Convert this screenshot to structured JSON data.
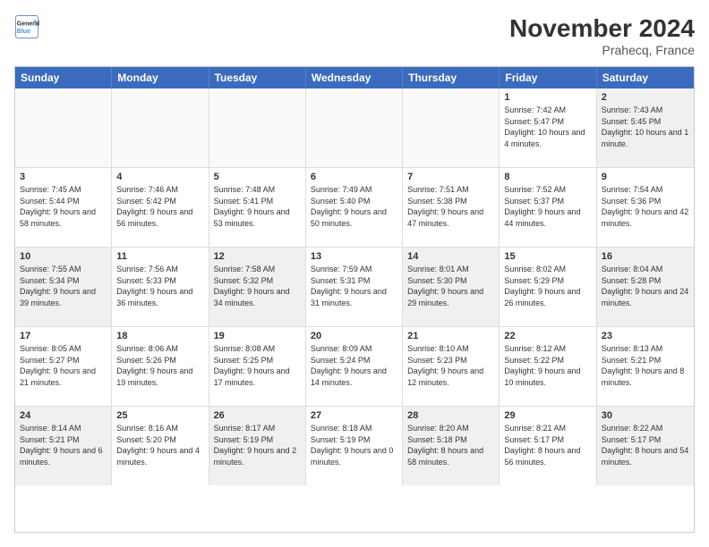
{
  "logo": {
    "line1": "General",
    "line2": "Blue"
  },
  "header": {
    "month_year": "November 2024",
    "location": "Prahecq, France"
  },
  "weekdays": [
    "Sunday",
    "Monday",
    "Tuesday",
    "Wednesday",
    "Thursday",
    "Friday",
    "Saturday"
  ],
  "rows": [
    [
      {
        "day": "",
        "empty": true
      },
      {
        "day": "",
        "empty": true
      },
      {
        "day": "",
        "empty": true
      },
      {
        "day": "",
        "empty": true
      },
      {
        "day": "",
        "empty": true
      },
      {
        "day": "1",
        "sunrise": "7:42 AM",
        "sunset": "5:47 PM",
        "daylight": "10 hours and 4 minutes."
      },
      {
        "day": "2",
        "sunrise": "7:43 AM",
        "sunset": "5:45 PM",
        "daylight": "10 hours and 1 minute."
      }
    ],
    [
      {
        "day": "3",
        "sunrise": "7:45 AM",
        "sunset": "5:44 PM",
        "daylight": "9 hours and 58 minutes."
      },
      {
        "day": "4",
        "sunrise": "7:46 AM",
        "sunset": "5:42 PM",
        "daylight": "9 hours and 56 minutes."
      },
      {
        "day": "5",
        "sunrise": "7:48 AM",
        "sunset": "5:41 PM",
        "daylight": "9 hours and 53 minutes."
      },
      {
        "day": "6",
        "sunrise": "7:49 AM",
        "sunset": "5:40 PM",
        "daylight": "9 hours and 50 minutes."
      },
      {
        "day": "7",
        "sunrise": "7:51 AM",
        "sunset": "5:38 PM",
        "daylight": "9 hours and 47 minutes."
      },
      {
        "day": "8",
        "sunrise": "7:52 AM",
        "sunset": "5:37 PM",
        "daylight": "9 hours and 44 minutes."
      },
      {
        "day": "9",
        "sunrise": "7:54 AM",
        "sunset": "5:36 PM",
        "daylight": "9 hours and 42 minutes."
      }
    ],
    [
      {
        "day": "10",
        "sunrise": "7:55 AM",
        "sunset": "5:34 PM",
        "daylight": "9 hours and 39 minutes."
      },
      {
        "day": "11",
        "sunrise": "7:56 AM",
        "sunset": "5:33 PM",
        "daylight": "9 hours and 36 minutes."
      },
      {
        "day": "12",
        "sunrise": "7:58 AM",
        "sunset": "5:32 PM",
        "daylight": "9 hours and 34 minutes."
      },
      {
        "day": "13",
        "sunrise": "7:59 AM",
        "sunset": "5:31 PM",
        "daylight": "9 hours and 31 minutes."
      },
      {
        "day": "14",
        "sunrise": "8:01 AM",
        "sunset": "5:30 PM",
        "daylight": "9 hours and 29 minutes."
      },
      {
        "day": "15",
        "sunrise": "8:02 AM",
        "sunset": "5:29 PM",
        "daylight": "9 hours and 26 minutes."
      },
      {
        "day": "16",
        "sunrise": "8:04 AM",
        "sunset": "5:28 PM",
        "daylight": "9 hours and 24 minutes."
      }
    ],
    [
      {
        "day": "17",
        "sunrise": "8:05 AM",
        "sunset": "5:27 PM",
        "daylight": "9 hours and 21 minutes."
      },
      {
        "day": "18",
        "sunrise": "8:06 AM",
        "sunset": "5:26 PM",
        "daylight": "9 hours and 19 minutes."
      },
      {
        "day": "19",
        "sunrise": "8:08 AM",
        "sunset": "5:25 PM",
        "daylight": "9 hours and 17 minutes."
      },
      {
        "day": "20",
        "sunrise": "8:09 AM",
        "sunset": "5:24 PM",
        "daylight": "9 hours and 14 minutes."
      },
      {
        "day": "21",
        "sunrise": "8:10 AM",
        "sunset": "5:23 PM",
        "daylight": "9 hours and 12 minutes."
      },
      {
        "day": "22",
        "sunrise": "8:12 AM",
        "sunset": "5:22 PM",
        "daylight": "9 hours and 10 minutes."
      },
      {
        "day": "23",
        "sunrise": "8:13 AM",
        "sunset": "5:21 PM",
        "daylight": "9 hours and 8 minutes."
      }
    ],
    [
      {
        "day": "24",
        "sunrise": "8:14 AM",
        "sunset": "5:21 PM",
        "daylight": "9 hours and 6 minutes."
      },
      {
        "day": "25",
        "sunrise": "8:16 AM",
        "sunset": "5:20 PM",
        "daylight": "9 hours and 4 minutes."
      },
      {
        "day": "26",
        "sunrise": "8:17 AM",
        "sunset": "5:19 PM",
        "daylight": "9 hours and 2 minutes."
      },
      {
        "day": "27",
        "sunrise": "8:18 AM",
        "sunset": "5:19 PM",
        "daylight": "9 hours and 0 minutes."
      },
      {
        "day": "28",
        "sunrise": "8:20 AM",
        "sunset": "5:18 PM",
        "daylight": "8 hours and 58 minutes."
      },
      {
        "day": "29",
        "sunrise": "8:21 AM",
        "sunset": "5:17 PM",
        "daylight": "8 hours and 56 minutes."
      },
      {
        "day": "30",
        "sunrise": "8:22 AM",
        "sunset": "5:17 PM",
        "daylight": "8 hours and 54 minutes."
      }
    ]
  ],
  "labels": {
    "sunrise_prefix": "Sunrise: ",
    "sunset_prefix": "Sunset: ",
    "daylight_prefix": "Daylight: "
  }
}
